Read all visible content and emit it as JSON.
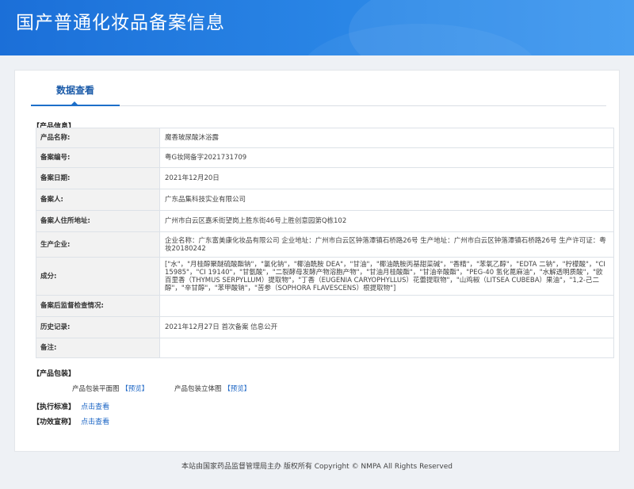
{
  "header": {
    "title": "国产普通化妆品备案信息"
  },
  "tabs": [
    {
      "label": "数据查看"
    }
  ],
  "product_section": {
    "title": "【产品信息】"
  },
  "product_rows": [
    {
      "key": "产品名称:",
      "value": "魔香玻尿酸沐浴露"
    },
    {
      "key": "备案编号:",
      "value": "粤G妆网备字2021731709"
    },
    {
      "key": "备案日期:",
      "value": "2021年12月20日"
    },
    {
      "key": "备案人:",
      "value": "广东品集科技实业有限公司"
    },
    {
      "key": "备案人住所地址:",
      "value": "广州市白云区嘉禾街望岗上胜东街46号上胜创意园第Q栋102"
    },
    {
      "key": "生产企业:",
      "value": "企业名称：广东富美康化妆品有限公司 企业地址：广州市白云区钟落潭镇石桥路26号 生产地址：广州市白云区钟落潭镇石桥路26号 生产许可证：粤妆20180242"
    },
    {
      "key": "成分:",
      "value": "[\"水\"，\"月桂醇聚醚硫酸酯钠\"，\"氯化钠\"，\"椰油酰胺 DEA\"，\"甘油\"，\"椰油酰胺丙基甜菜碱\"，\"香精\"，\"苯氧乙醇\"，\"EDTA 二钠\"，\"柠檬酸\"，\"CI 15985\"，\"CI 19140\"，\"甘氨酸\"，\"二裂酵母发酵产物溶胞产物\"，\"甘油月桂酸酯\"，\"甘油辛酸酯\"，\"PEG-40 氢化蓖麻油\"，\"水解透明质酸\"，\"欧百里香（THYMUS SERPYLLUM）提取物\"，\"丁香（EUGENIA CARYOPHYLLUS）花蕾提取物\"，\"山鸡椒（LITSEA CUBEBA）果油\"，\"1,2-己二醇\"，\"辛甘醇\"，\"苯甲酸钠\"，\"苦参（SOPHORA FLAVESCENS）根提取物\"]"
    },
    {
      "key": "备案后监督检查情况:",
      "value": ""
    },
    {
      "key": "历史记录:",
      "value": "2021年12月27日 首次备案 信息公开"
    },
    {
      "key": "备注:",
      "value": ""
    }
  ],
  "packaging": {
    "title": "【产品包装】",
    "flat_label": "产品包装平面图",
    "flat_link": "【预览】",
    "solid_label": "产品包装立体图",
    "solid_link": "【预览】"
  },
  "standard": {
    "title": "【执行标准】",
    "link": "点击查看"
  },
  "claims": {
    "title": "【功效宣称】",
    "link": "点击查看"
  },
  "footer": {
    "text": "本站由国家药品监督管理局主办 版权所有 Copyright © NMPA All Rights Reserved"
  }
}
